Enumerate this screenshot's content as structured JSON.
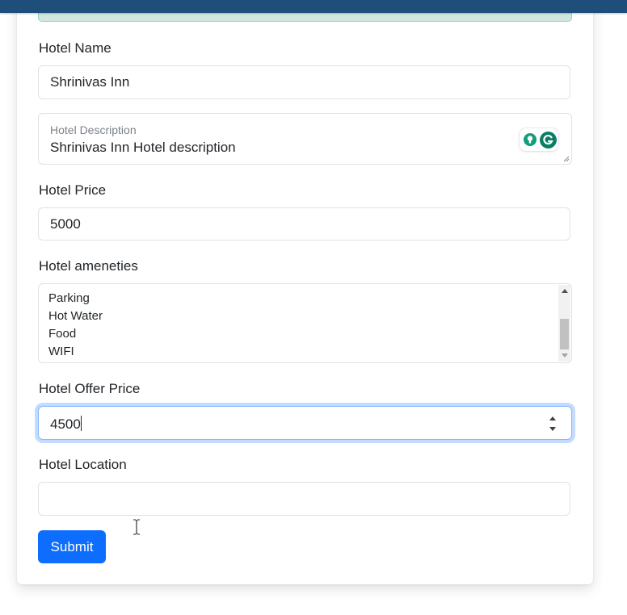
{
  "form": {
    "hotel_name": {
      "label": "Hotel Name",
      "value": "Shrinivas Inn"
    },
    "hotel_description": {
      "floating_label": "Hotel Description",
      "value": "Shrinivas Inn Hotel description"
    },
    "hotel_price": {
      "label": "Hotel Price",
      "value": "5000"
    },
    "hotel_amenities": {
      "label": "Hotel ameneties",
      "options": [
        "Parking",
        "Hot Water",
        "Food",
        "WIFI"
      ]
    },
    "hotel_offer_price": {
      "label": "Hotel Offer Price",
      "value": "4500"
    },
    "hotel_location": {
      "label": "Hotel Location",
      "value": ""
    },
    "submit_label": "Submit"
  },
  "colors": {
    "top_bar": "#1f4e7a",
    "primary_button": "#0d6efd",
    "focus_ring": "#86b7fe",
    "alert_strip": "#d1e7dd"
  },
  "icons": [
    "grammarly-suggestion-icon",
    "grammarly-logo-icon",
    "text-cursor-icon",
    "spinner-up-icon",
    "spinner-down-icon"
  ]
}
